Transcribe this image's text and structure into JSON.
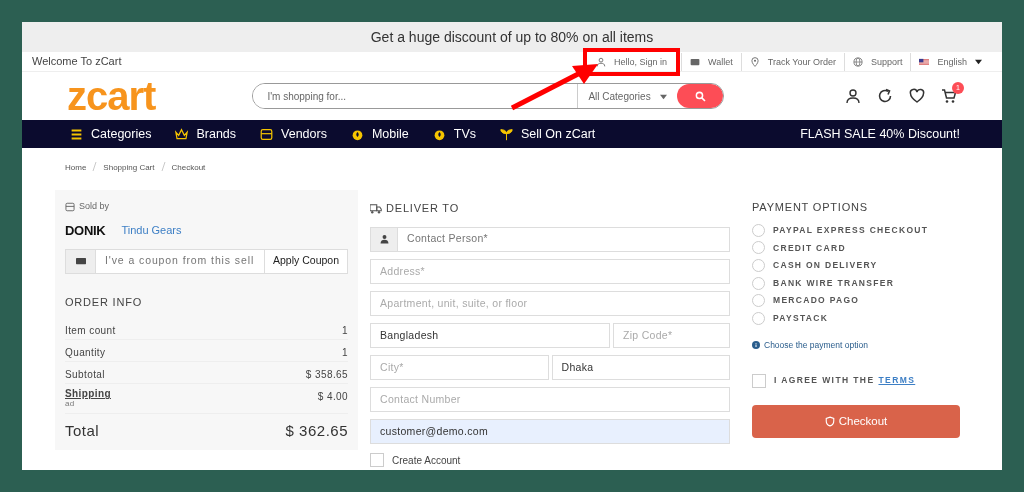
{
  "banner": "Get a huge discount of up to 80% on all items",
  "top_bar": {
    "welcome": "Welcome To zCart",
    "links": [
      {
        "label": "Hello, Sign in",
        "kind": "user",
        "highlighted": true
      },
      {
        "label": "Wallet",
        "kind": "wallet",
        "highlighted": false
      },
      {
        "label": "Track Your Order",
        "kind": "pin",
        "highlighted": false
      },
      {
        "label": "Support",
        "kind": "globe",
        "highlighted": false
      },
      {
        "label": "English",
        "kind": "flag",
        "highlighted": false
      }
    ]
  },
  "header": {
    "logo": "zcart",
    "search": {
      "placeholder": "I'm shopping for...",
      "category": "All Categories"
    },
    "cart_count": "1"
  },
  "nav": {
    "items": [
      {
        "label": "Categories",
        "kind": "bars"
      },
      {
        "label": "Brands",
        "kind": "crown"
      },
      {
        "label": "Vendors",
        "kind": "store"
      },
      {
        "label": "Mobile",
        "kind": "fire"
      },
      {
        "label": "TVs",
        "kind": "fire"
      },
      {
        "label": "Sell On zCart",
        "kind": "sprout"
      }
    ],
    "promo": "FLASH SALE 40% Discount!"
  },
  "breadcrumb": [
    "Home",
    "Shopping Cart",
    "Checkout"
  ],
  "seller": {
    "heading": "Sold by",
    "logo": "DONIK",
    "name": "Tindu Gears"
  },
  "coupon": {
    "placeholder": "I've a coupon from this sell",
    "button": "Apply Coupon"
  },
  "order_info": {
    "title": "ORDER INFO",
    "rows": [
      {
        "label": "Item count",
        "value": "1",
        "kind": "plain"
      },
      {
        "label": "Quantity",
        "value": "1",
        "kind": "plain"
      },
      {
        "label": "Subtotal",
        "value": "$ 358.65",
        "kind": "plain"
      },
      {
        "label": "Shipping",
        "value": "$ 4.00",
        "kind": "link",
        "note": "ad"
      }
    ],
    "total": {
      "label": "Total",
      "value": "$ 362.65"
    }
  },
  "deliver": {
    "title": "DELIVER TO",
    "rows": [
      [
        {
          "placeholder": "Contact Person*",
          "kind": "person"
        }
      ],
      [
        {
          "placeholder": "Address*",
          "kind": "text"
        }
      ],
      [
        {
          "placeholder": "Apartment, unit, suite, or floor",
          "kind": "text"
        }
      ],
      [
        {
          "value": "Bangladesh",
          "kind": "text"
        },
        {
          "placeholder": "Zip Code*",
          "kind": "narrow"
        }
      ],
      [
        {
          "placeholder": "City*",
          "kind": "text"
        },
        {
          "value": "Dhaka",
          "kind": "text"
        }
      ],
      [
        {
          "placeholder": "Contact Number",
          "kind": "text"
        }
      ],
      [
        {
          "value": "customer@demo.com",
          "kind": "autofill"
        }
      ]
    ],
    "create_account": {
      "label": "Create Account",
      "checked": false
    }
  },
  "payment": {
    "title": "PAYMENT OPTIONS",
    "options": [
      {
        "label": "PAYPAL EXPRESS CHECKOUT",
        "selected": false
      },
      {
        "label": "CREDIT CARD",
        "selected": false
      },
      {
        "label": "CASH ON DELIVERY",
        "selected": false
      },
      {
        "label": "BANK WIRE TRANSFER",
        "selected": false
      },
      {
        "label": "MERCADO PAGO",
        "selected": false
      },
      {
        "label": "PAYSTACK",
        "selected": false
      }
    ],
    "hint": "Choose the payment option",
    "agree": {
      "text": "I AGREE WITH THE",
      "link": "TERMS",
      "checked": false
    },
    "button": "Checkout"
  }
}
